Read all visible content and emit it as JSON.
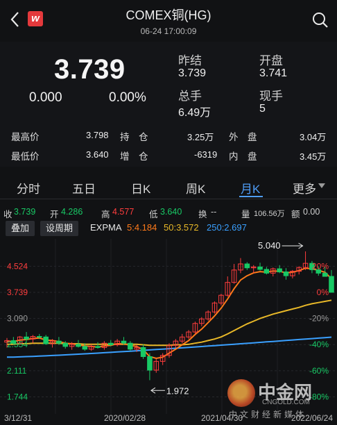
{
  "header": {
    "title": "COMEX铜(HG)",
    "subtitle": "06-24 17:00:09",
    "logo_text": "w"
  },
  "quote": {
    "price": "3.739",
    "change": "0.000",
    "change_pct": "0.00%",
    "prev_close_label": "昨结",
    "prev_close": "3.739",
    "open_label": "开盘",
    "open": "3.741",
    "total_vol_label": "总手",
    "total_vol": "6.49万",
    "current_vol_label": "现手",
    "current_vol": "5"
  },
  "stats": {
    "high_label": "最高价",
    "high": "3.798",
    "low_label": "最低价",
    "low": "3.640",
    "oi_label": "持　仓",
    "oi": "3.25万",
    "oi_chg_label": "增　仓",
    "oi_chg": "-6319",
    "outer_label": "外　盘",
    "outer": "3.04万",
    "inner_label": "内　盘",
    "inner": "3.45万"
  },
  "tabs": [
    "分时",
    "五日",
    "日K",
    "周K",
    "月K",
    "更多"
  ],
  "active_tab": "月K",
  "info_row": {
    "close_label": "收",
    "close": "3.739",
    "open_label": "开",
    "open": "4.286",
    "high_label": "高",
    "high": "4.577",
    "low_label": "低",
    "low": "3.640",
    "turnover_label": "换",
    "turnover": "--",
    "vol_label": "量",
    "vol": "106.56万",
    "amount_label": "额",
    "amount": "0.00"
  },
  "buttons": {
    "overlay": "叠加",
    "period": "设周期"
  },
  "ema": {
    "label": "EXPMA",
    "e5": "5:4.184",
    "e50": "50:3.572",
    "e250": "250:2.697"
  },
  "colors": {
    "up": "#ff3d3d",
    "down": "#18c965",
    "ema5": "#ff7a1a",
    "ema50": "#e8b828",
    "ema250": "#3aa0ff",
    "active_tab": "#4f9df7"
  },
  "chart_data": {
    "type": "candlestick",
    "y_ticks_left": [
      "4.524",
      "3.739",
      "3.090",
      "2.554",
      "2.111",
      "1.744"
    ],
    "y_ticks_right": [
      "20%",
      "0%",
      "-20%",
      "-40%",
      "-60%",
      "-80%"
    ],
    "x_ticks": [
      "3/12/31",
      "2020/02/28",
      "2021/04/30",
      "2022/06/24"
    ],
    "annotation_high": "5.040",
    "annotation_low": "1.972",
    "candles": [
      [
        2.6,
        2.68,
        2.5,
        2.63
      ],
      [
        2.63,
        2.7,
        2.55,
        2.58
      ],
      [
        2.58,
        2.72,
        2.55,
        2.7
      ],
      [
        2.7,
        2.8,
        2.62,
        2.66
      ],
      [
        2.66,
        2.74,
        2.58,
        2.71
      ],
      [
        2.71,
        2.76,
        2.66,
        2.7
      ],
      [
        2.7,
        2.74,
        2.55,
        2.57
      ],
      [
        2.57,
        2.66,
        2.5,
        2.62
      ],
      [
        2.62,
        2.7,
        2.55,
        2.58
      ],
      [
        2.58,
        2.62,
        2.48,
        2.52
      ],
      [
        2.52,
        2.6,
        2.46,
        2.56
      ],
      [
        2.56,
        2.64,
        2.5,
        2.52
      ],
      [
        2.52,
        2.58,
        2.44,
        2.47
      ],
      [
        2.47,
        2.56,
        2.44,
        2.52
      ],
      [
        2.52,
        2.6,
        2.48,
        2.5
      ],
      [
        2.5,
        2.62,
        2.46,
        2.58
      ],
      [
        2.58,
        2.64,
        2.52,
        2.55
      ],
      [
        2.55,
        2.66,
        2.52,
        2.62
      ],
      [
        2.62,
        2.7,
        2.55,
        2.58
      ],
      [
        2.58,
        2.62,
        2.44,
        2.47
      ],
      [
        2.47,
        2.55,
        2.42,
        2.5
      ],
      [
        2.5,
        2.56,
        2.3,
        2.34
      ],
      [
        2.34,
        2.4,
        1.97,
        2.12
      ],
      [
        2.12,
        2.3,
        2.08,
        2.26
      ],
      [
        2.26,
        2.4,
        2.2,
        2.36
      ],
      [
        2.36,
        2.58,
        2.32,
        2.54
      ],
      [
        2.54,
        2.66,
        2.5,
        2.62
      ],
      [
        2.62,
        2.76,
        2.58,
        2.7
      ],
      [
        2.7,
        2.84,
        2.66,
        2.8
      ],
      [
        2.8,
        3.02,
        2.76,
        2.98
      ],
      [
        2.98,
        3.12,
        2.92,
        3.08
      ],
      [
        3.08,
        3.28,
        3.04,
        3.24
      ],
      [
        3.24,
        3.5,
        3.2,
        3.46
      ],
      [
        3.46,
        3.7,
        3.4,
        3.66
      ],
      [
        3.66,
        4.2,
        3.62,
        4.02
      ],
      [
        4.02,
        4.6,
        3.98,
        4.4
      ],
      [
        4.4,
        4.8,
        4.3,
        4.6
      ],
      [
        4.6,
        4.66,
        4.4,
        4.47
      ],
      [
        4.47,
        4.56,
        4.3,
        4.5
      ],
      [
        4.5,
        4.64,
        4.38,
        4.42
      ],
      [
        4.42,
        4.5,
        4.26,
        4.3
      ],
      [
        4.3,
        4.48,
        4.2,
        4.44
      ],
      [
        4.44,
        4.56,
        4.3,
        4.34
      ],
      [
        4.34,
        4.46,
        4.1,
        4.22
      ],
      [
        4.22,
        4.4,
        4.14,
        4.36
      ],
      [
        4.36,
        4.52,
        4.26,
        4.48
      ],
      [
        4.48,
        5.04,
        4.4,
        4.62
      ],
      [
        4.62,
        4.7,
        4.3,
        4.41
      ],
      [
        4.41,
        4.52,
        4.22,
        4.3
      ],
      [
        4.3,
        4.5,
        4.24,
        4.2
      ],
      [
        4.2,
        4.4,
        3.74,
        3.74
      ]
    ],
    "ema5": [
      2.62,
      2.61,
      2.64,
      2.65,
      2.67,
      2.68,
      2.64,
      2.63,
      2.61,
      2.58,
      2.57,
      2.55,
      2.53,
      2.52,
      2.51,
      2.53,
      2.54,
      2.57,
      2.57,
      2.54,
      2.52,
      2.46,
      2.34,
      2.31,
      2.33,
      2.4,
      2.47,
      2.55,
      2.63,
      2.75,
      2.86,
      3.0,
      3.15,
      3.33,
      3.56,
      3.84,
      4.09,
      4.22,
      4.31,
      4.35,
      4.33,
      4.37,
      4.36,
      4.31,
      4.33,
      4.38,
      4.46,
      4.44,
      4.39,
      4.33,
      4.13
    ],
    "ema50": [
      2.56,
      2.56,
      2.57,
      2.57,
      2.58,
      2.58,
      2.58,
      2.58,
      2.58,
      2.57,
      2.57,
      2.57,
      2.56,
      2.56,
      2.56,
      2.56,
      2.56,
      2.56,
      2.56,
      2.56,
      2.56,
      2.55,
      2.54,
      2.54,
      2.54,
      2.54,
      2.55,
      2.55,
      2.56,
      2.58,
      2.6,
      2.63,
      2.66,
      2.7,
      2.76,
      2.83,
      2.9,
      2.97,
      3.03,
      3.09,
      3.14,
      3.19,
      3.23,
      3.27,
      3.31,
      3.35,
      3.4,
      3.44,
      3.47,
      3.5,
      3.53
    ]
  }
}
